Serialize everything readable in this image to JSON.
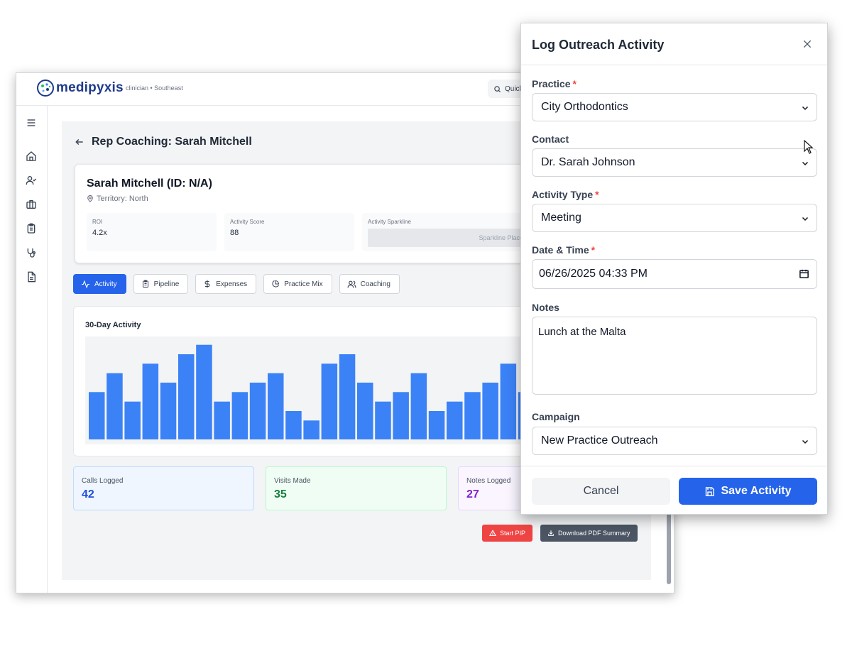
{
  "app": {
    "brand": "medipyxis",
    "user_context": "clinician • Southeast",
    "search_label": "Quick"
  },
  "sidebar": {
    "items": [
      {
        "icon": "menu-icon"
      },
      {
        "icon": "home-icon"
      },
      {
        "icon": "user-check-icon"
      },
      {
        "icon": "briefcase-icon"
      },
      {
        "icon": "clipboard-icon"
      },
      {
        "icon": "stethoscope-icon"
      },
      {
        "icon": "file-text-icon"
      }
    ]
  },
  "page": {
    "title": "Rep Coaching: Sarah Mitchell"
  },
  "rep": {
    "name": "Sarah Mitchell (ID: N/A)",
    "territory": "Territory: North",
    "kpis": [
      {
        "label": "ROI",
        "value": "4.2x"
      },
      {
        "label": "Activity Score",
        "value": "88"
      },
      {
        "label": "Activity Sparkline",
        "placeholder": "Sparkline Placehold"
      }
    ]
  },
  "tabs": [
    {
      "label": "Activity",
      "icon": "activity-icon",
      "active": true
    },
    {
      "label": "Pipeline",
      "icon": "clipboard-icon",
      "active": false
    },
    {
      "label": "Expenses",
      "icon": "dollar-icon",
      "active": false
    },
    {
      "label": "Practice Mix",
      "icon": "pie-chart-icon",
      "active": false
    },
    {
      "label": "Coaching",
      "icon": "users-icon",
      "active": false
    }
  ],
  "chart_data": {
    "type": "bar",
    "title": "30-Day Activity",
    "color": "#3b82f6",
    "values": [
      5,
      7,
      4,
      8,
      6,
      9,
      10,
      4,
      5,
      6,
      7,
      3,
      2,
      8,
      9,
      6,
      4,
      5,
      7,
      3,
      4,
      5,
      6,
      8,
      5
    ],
    "ylim": [
      0,
      10.5
    ]
  },
  "stats": [
    {
      "label": "Calls Logged",
      "value": "42"
    },
    {
      "label": "Visits Made",
      "value": "35"
    },
    {
      "label": "Notes Logged",
      "value": "27"
    }
  ],
  "actions": {
    "start_pip": "Start PIP",
    "download_pdf": "Download PDF Summary"
  },
  "modal": {
    "title": "Log Outreach Activity",
    "practice": {
      "label": "Practice",
      "required": "*",
      "value": "City Orthodontics"
    },
    "contact": {
      "label": "Contact",
      "value": "Dr. Sarah Johnson"
    },
    "activity_type": {
      "label": "Activity Type",
      "required": "*",
      "value": "Meeting"
    },
    "datetime": {
      "label": "Date & Time",
      "required": "*",
      "value": "06/26/2025 04:33 PM"
    },
    "notes": {
      "label": "Notes",
      "value": "Lunch at the Malta"
    },
    "campaign": {
      "label": "Campaign",
      "value": "New Practice Outreach"
    },
    "cancel_label": "Cancel",
    "save_label": "Save Activity"
  },
  "colors": {
    "primary": "#2563eb",
    "danger": "#ef4444",
    "bar": "#3b82f6"
  }
}
